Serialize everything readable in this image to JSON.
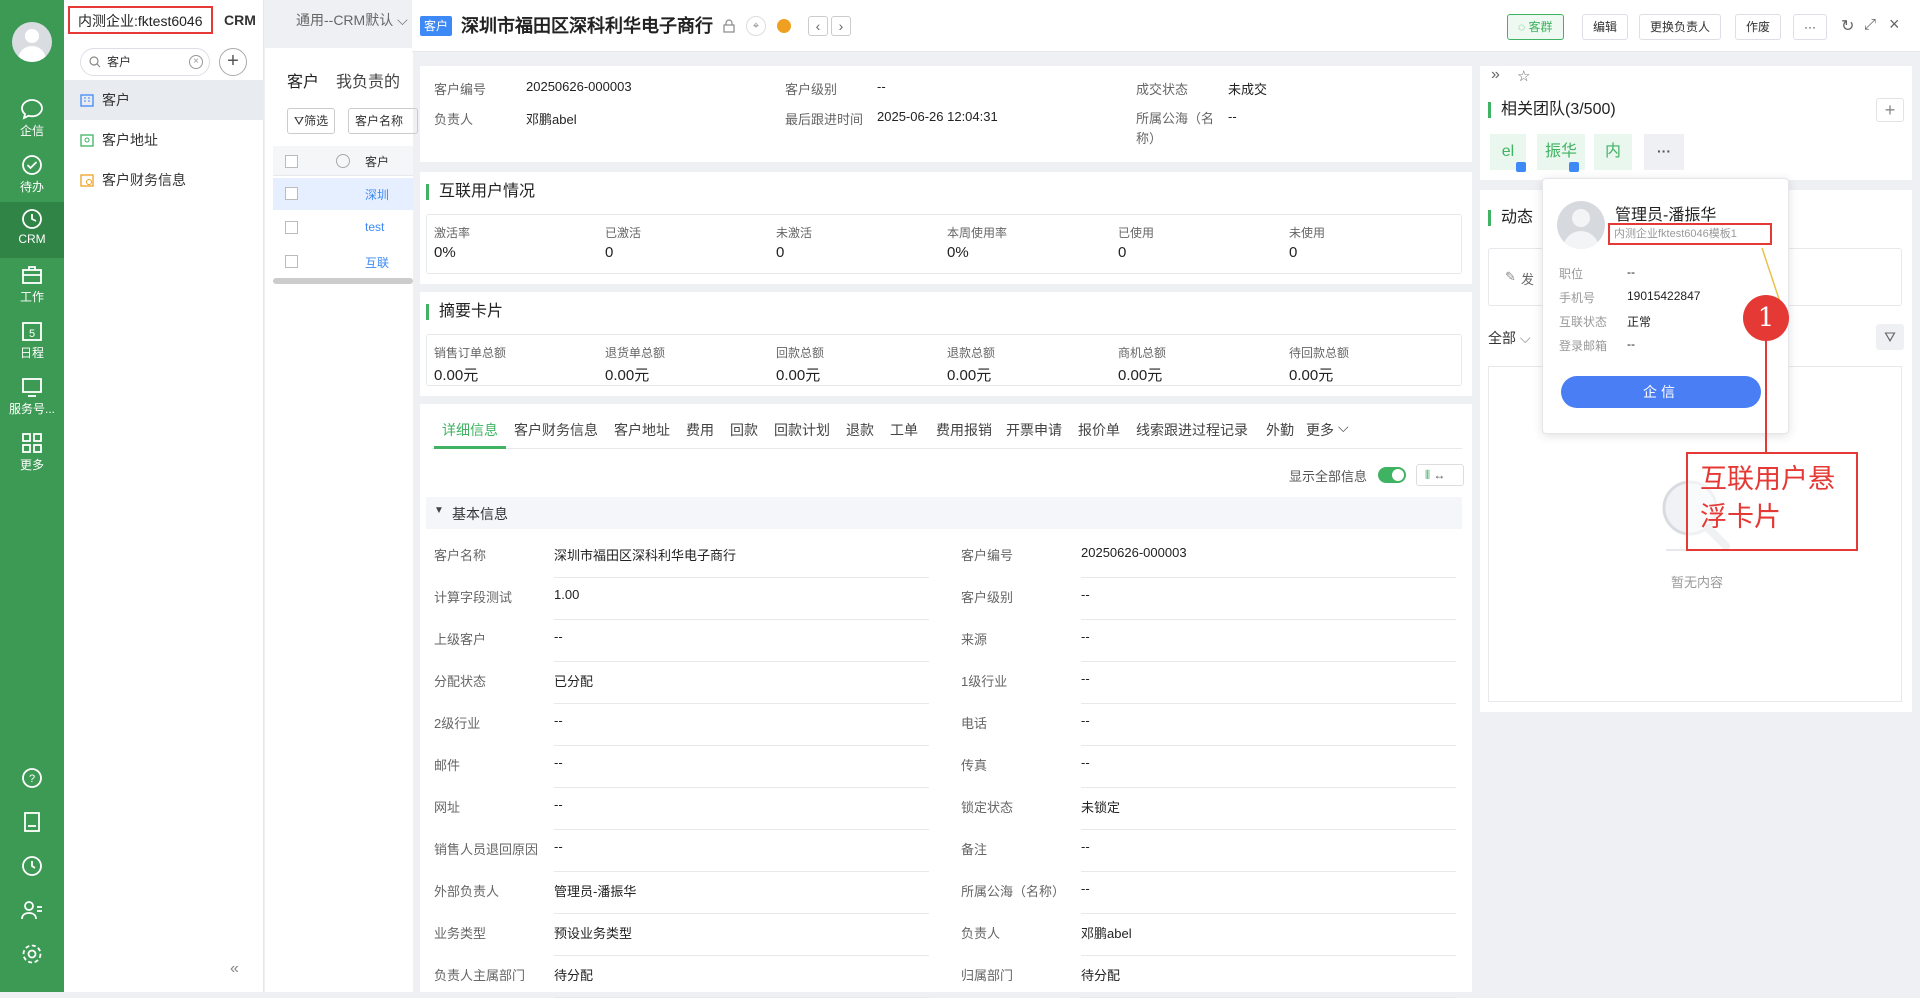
{
  "rail": {
    "items": [
      {
        "label": "企信"
      },
      {
        "label": "待办"
      },
      {
        "label": "CRM"
      },
      {
        "label": "工作"
      },
      {
        "label": "日程",
        "badge": "5"
      },
      {
        "label": "服务号..."
      },
      {
        "label": "更多"
      }
    ]
  },
  "topbar": {
    "enterprise": "内测企业:fktest6046",
    "app": "CRM",
    "view": "通用--CRM默认"
  },
  "search": {
    "value": "客户"
  },
  "sidebar": {
    "items": [
      {
        "label": "客户"
      },
      {
        "label": "客户地址"
      },
      {
        "label": "客户财务信息"
      }
    ]
  },
  "list": {
    "tabs": [
      "客户",
      "我负责的"
    ],
    "filter": "筛选",
    "field": "客户名称",
    "col": "客户",
    "rows": [
      "深圳",
      "test",
      "互联"
    ]
  },
  "header": {
    "badge": "客户",
    "title": "深圳市福田区深科利华电子商行",
    "buttons": {
      "group": "客群",
      "edit": "编辑",
      "change": "更换负责人",
      "void": "作废",
      "more": "···"
    }
  },
  "summary": {
    "customer_no_label": "客户编号",
    "customer_no": "20250626-000003",
    "level_label": "客户级别",
    "level": "--",
    "deal_label": "成交状态",
    "deal": "未成交",
    "owner_label": "负责人",
    "owner": "邓鹏abel",
    "follow_label": "最后跟进时间",
    "follow": "2025-06-26 12:04:31",
    "pool_label": "所属公海（名称）",
    "pool": "--"
  },
  "users": {
    "title": "互联用户情况",
    "stats": [
      {
        "label": "激活率",
        "value": "0%"
      },
      {
        "label": "已激活",
        "value": "0"
      },
      {
        "label": "未激活",
        "value": "0"
      },
      {
        "label": "本周使用率",
        "value": "0%"
      },
      {
        "label": "已使用",
        "value": "0"
      },
      {
        "label": "未使用",
        "value": "0"
      }
    ]
  },
  "digest": {
    "title": "摘要卡片",
    "stats": [
      {
        "label": "销售订单总额",
        "value": "0.00元"
      },
      {
        "label": "退货单总额",
        "value": "0.00元"
      },
      {
        "label": "回款总额",
        "value": "0.00元"
      },
      {
        "label": "退款总额",
        "value": "0.00元"
      },
      {
        "label": "商机总额",
        "value": "0.00元"
      },
      {
        "label": "待回款总额",
        "value": "0.00元"
      }
    ]
  },
  "detail_tabs": [
    "详细信息",
    "客户财务信息",
    "客户地址",
    "费用",
    "回款",
    "回款计划",
    "退款",
    "工单",
    "费用报销",
    "开票申请",
    "报价单",
    "线索跟进过程记录",
    "外勤",
    "更多"
  ],
  "show_all": "显示全部信息",
  "section": "基本信息",
  "fields": [
    [
      {
        "label": "客户名称",
        "value": "深圳市福田区深科利华电子商行"
      },
      {
        "label": "客户编号",
        "value": "20250626-000003"
      }
    ],
    [
      {
        "label": "计算字段测试",
        "value": "1.00"
      },
      {
        "label": "客户级别",
        "value": "--"
      }
    ],
    [
      {
        "label": "上级客户",
        "value": "--"
      },
      {
        "label": "来源",
        "value": "--"
      }
    ],
    [
      {
        "label": "分配状态",
        "value": "已分配"
      },
      {
        "label": "1级行业",
        "value": "--"
      }
    ],
    [
      {
        "label": "2级行业",
        "value": "--"
      },
      {
        "label": "电话",
        "value": "--"
      }
    ],
    [
      {
        "label": "邮件",
        "value": "--"
      },
      {
        "label": "传真",
        "value": "--"
      }
    ],
    [
      {
        "label": "网址",
        "value": "--"
      },
      {
        "label": "锁定状态",
        "value": "未锁定"
      }
    ],
    [
      {
        "label": "销售人员退回原因",
        "value": "--"
      },
      {
        "label": "备注",
        "value": "--"
      }
    ],
    [
      {
        "label": "外部负责人",
        "value": "管理员-潘振华"
      },
      {
        "label": "所属公海（名称）",
        "value": "--"
      }
    ],
    [
      {
        "label": "业务类型",
        "value": "预设业务类型"
      },
      {
        "label": "负责人",
        "value": "邓鹏abel"
      }
    ],
    [
      {
        "label": "负责人主属部门",
        "value": "待分配"
      },
      {
        "label": "归属部门",
        "value": "待分配"
      }
    ]
  ],
  "team": {
    "title": "相关团队(3/500)",
    "members": [
      "el",
      "振华",
      "内"
    ],
    "more": "···"
  },
  "feed": {
    "title": "动态",
    "post": "发",
    "filter": "全部",
    "empty": "暂无内容"
  },
  "popup": {
    "name": "管理员-潘振华",
    "org": "内测企业fktest6046模板1",
    "rows": [
      {
        "label": "职位",
        "value": "--"
      },
      {
        "label": "手机号",
        "value": "19015422847"
      },
      {
        "label": "互联状态",
        "value": "正常"
      },
      {
        "label": "登录邮箱",
        "value": "--"
      }
    ],
    "button": "企信"
  },
  "annotation": {
    "number": "1",
    "text": "互联用户悬浮卡片"
  },
  "colors": {
    "brand": "#3d9a55",
    "accent": "#3fb362",
    "link": "#3d8af7",
    "annotation": "#e53935"
  }
}
